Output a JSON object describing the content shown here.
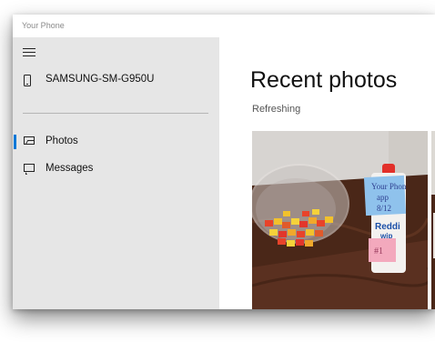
{
  "window": {
    "title": "Your Phone"
  },
  "sidebar": {
    "menu_icon": "hamburger-menu-icon",
    "device": {
      "name": "SAMSUNG-SM-G950U",
      "icon": "phone-icon"
    },
    "items": [
      {
        "label": "Photos",
        "icon": "photo-icon",
        "selected": true
      },
      {
        "label": "Messages",
        "icon": "message-icon",
        "selected": false
      }
    ]
  },
  "main": {
    "title": "Recent photos",
    "status": "Refreshing",
    "photos": [
      {
        "description": "bowl of candy next to whipped cream can with sticky note",
        "note_text": "Your Phone app 8/12",
        "can_label": "Reddi wip",
        "label_text": "#1"
      },
      {
        "description": "partially visible photo"
      }
    ]
  },
  "colors": {
    "accent": "#0078d7",
    "sidebar_bg": "#e6e6e6"
  }
}
